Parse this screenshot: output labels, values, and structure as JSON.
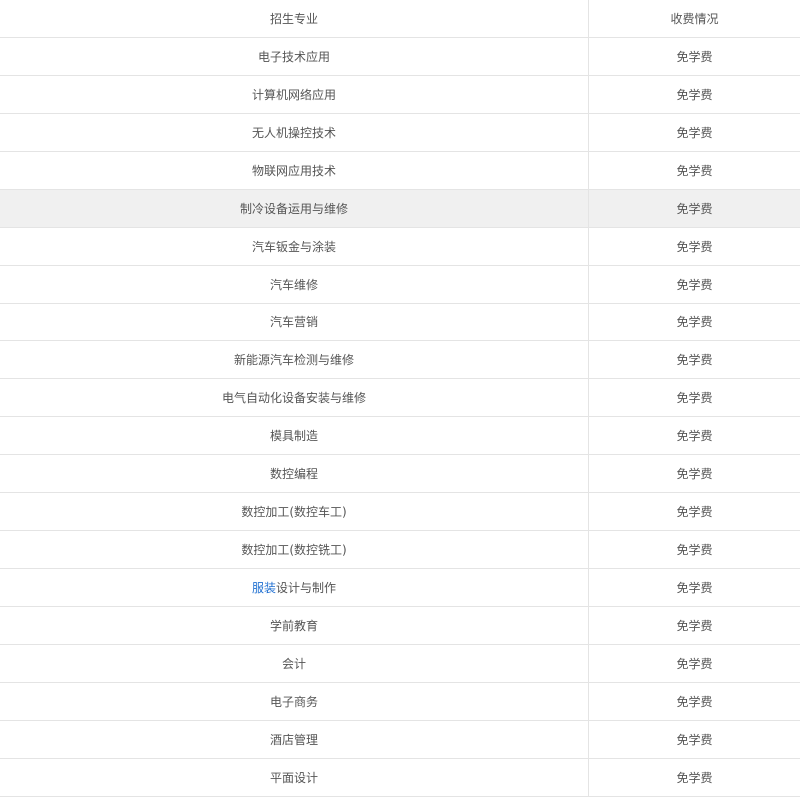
{
  "header": {
    "major": "招生专业",
    "fee": "收费情况"
  },
  "rows": [
    {
      "major": "电子技术应用",
      "fee": "免学费"
    },
    {
      "major": "计算机网络应用",
      "fee": "免学费"
    },
    {
      "major": "无人机操控技术",
      "fee": "免学费"
    },
    {
      "major": "物联网应用技术",
      "fee": "免学费"
    },
    {
      "major": "制冷设备运用与维修",
      "fee": "免学费"
    },
    {
      "major": "汽车钣金与涂装",
      "fee": "免学费"
    },
    {
      "major": "汽车维修",
      "fee": "免学费"
    },
    {
      "major": "汽车营销",
      "fee": "免学费"
    },
    {
      "major": "新能源汽车检测与维修",
      "fee": "免学费"
    },
    {
      "major": "电气自动化设备安装与维修",
      "fee": "免学费"
    },
    {
      "major": "模具制造",
      "fee": "免学费"
    },
    {
      "major": "数控编程",
      "fee": "免学费"
    },
    {
      "major": "数控加工(数控车工)",
      "fee": "免学费"
    },
    {
      "major": "数控加工(数控铣工)",
      "fee": "免学费"
    },
    {
      "major_link": "服装",
      "major_rest": "设计与制作",
      "fee": "免学费"
    },
    {
      "major": "学前教育",
      "fee": "免学费"
    },
    {
      "major": "会计",
      "fee": "免学费"
    },
    {
      "major": "电子商务",
      "fee": "免学费"
    },
    {
      "major": "酒店管理",
      "fee": "免学费"
    },
    {
      "major": "平面设计",
      "fee": "免学费"
    }
  ]
}
